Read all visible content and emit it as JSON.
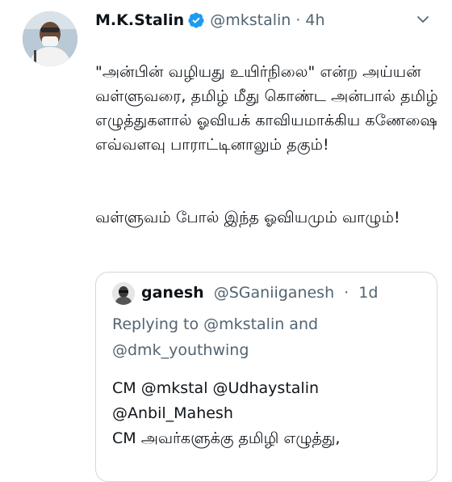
{
  "tweet": {
    "author_name": "M.K.Stalin",
    "handle": "@mkstalin",
    "separator": "·",
    "time": "4h",
    "text_paragraph_1": "\"அன்பின் வழியது உயிர்நிலை\" என்ற அய்யன் வள்ளுவரை, தமிழ் மீது கொண்ட அன்பால் தமிழ் எழுத்துகளால் ஓவியக் காவியமாக்கிய கணேஷை எவ்வளவு பாராட்டினாலும் தகும்!",
    "text_paragraph_2": "வள்ளுவம் போல் இந்த ஓவியமும் வாழும்!",
    "icons": {
      "verified": "verified-badge-icon",
      "more": "chevron-down-icon"
    },
    "colors": {
      "verified": "#1d9bf0",
      "secondary_text": "#536471",
      "border": "#cfd9de"
    }
  },
  "quoted_tweet": {
    "author_name": "ganesh",
    "handle": "@SGaniiganesh",
    "separator": "·",
    "time": "1d",
    "replying_to": "Replying to @mkstalin and @dmk_youthwing",
    "text_line_1": "CM @mkstal @Udhaystalin",
    "text_line_2": "@Anbil_Mahesh",
    "text_line_3": "CM அவர்களுக்கு தமிழி எழுத்து,"
  }
}
